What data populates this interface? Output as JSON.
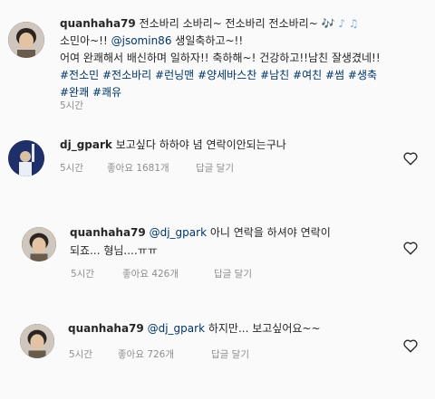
{
  "post": {
    "username": "quanhaha79",
    "line1": "전소바리 소바리~ 전소바리 전소바리~",
    "line2_pre": "소민아~!!",
    "line2_mention": "@jsomin86",
    "line2_post": "생일축하고~!!",
    "line3": "어여 완쾌해서 배신하며 일하자!! 축하해~! 건강하고!!남친 잘생겼네!!",
    "hashtags_line1": "#전소민 #전소바리 #런닝맨 #양세바스찬 #남친 #여친 #썸 #생축",
    "hashtags_line2": "#완쾌 #쾌유",
    "time": "5시간",
    "emoji": "🎶 ♪ ♫"
  },
  "comments": [
    {
      "username": "dj_gpark",
      "text": "보고싶다 하하야 념 연락이안되는구나",
      "time": "5시간",
      "likes": "좋아요 1681개",
      "reply": "답글 달기"
    },
    {
      "username": "quanhaha79",
      "mention": "@dj_gpark",
      "text_line1": "아니 연락을 하셔야 연락이",
      "text_line2": "되죠... 형님....ㅠㅠ",
      "time": "5시간",
      "likes": "좋아요 426개",
      "reply": "답글 달기"
    },
    {
      "username": "quanhaha79",
      "mention": "@dj_gpark",
      "text": "하지만... 보고싶어요~~",
      "time": "5시간",
      "likes": "좋아요 726개",
      "reply": "답글 달기"
    }
  ],
  "icons": [
    "heart-icon"
  ],
  "colors": {
    "background": "#fafafa",
    "link": "#003569",
    "meta": "#8e8e8e",
    "text": "#262626"
  }
}
